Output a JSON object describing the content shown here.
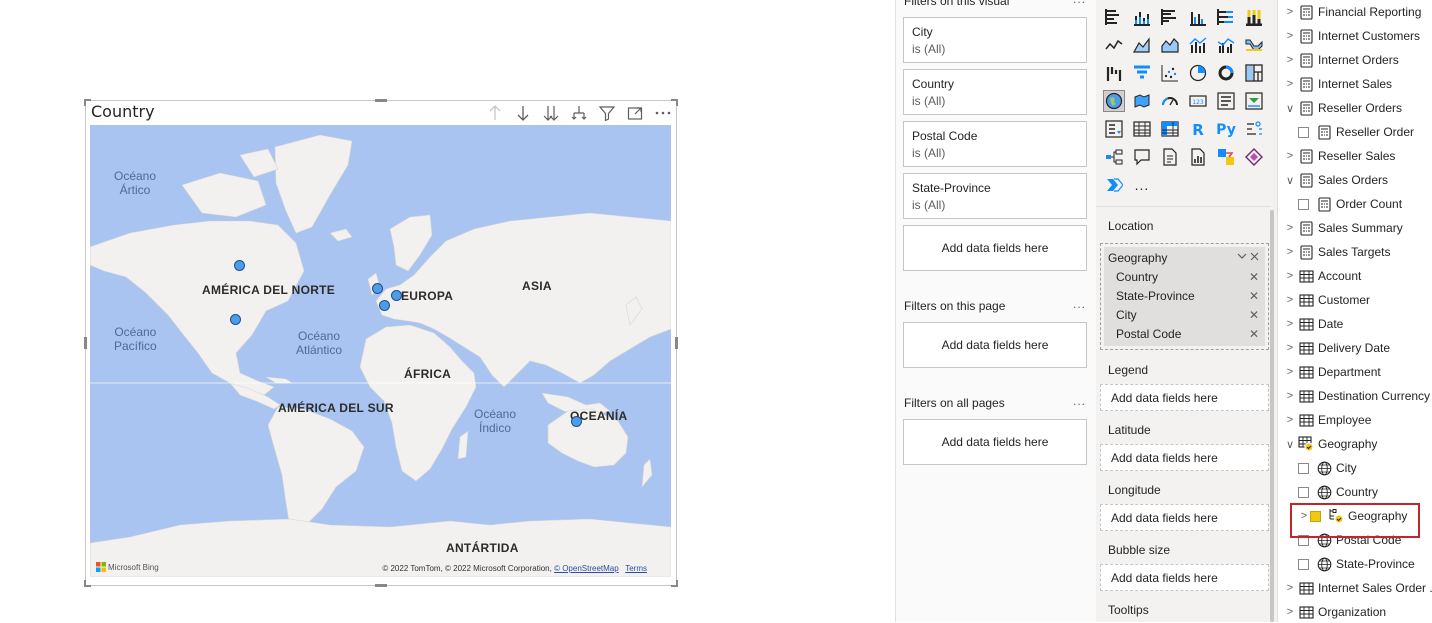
{
  "visual": {
    "title": "Country",
    "header_icons": [
      "arrow-up-icon",
      "arrow-down-icon",
      "expand-all-down-icon",
      "drill-hierarchy-icon",
      "filter-icon",
      "focus-mode-icon",
      "more-options-icon"
    ],
    "map": {
      "continent_labels": {
        "north_america": "AMÉRICA DEL NORTE",
        "europe": "EUROPA",
        "asia": "ASIA",
        "africa": "ÁFRICA",
        "south_america": "AMÉRICA DEL SUR",
        "oceania": "OCEANÍA",
        "antarctica": "ANTÁRTIDA"
      },
      "ocean_labels": {
        "arctic": "Océano\nÁrtico",
        "pacific": "Océano\nPacífico",
        "atlantic": "Océano\nAtlántico",
        "indian": "Océano\nÍndico"
      },
      "bing_logo": "Microsoft Bing",
      "attribution": "© 2022 TomTom, © 2022 Microsoft Corporation,",
      "osm_link": "© OpenStreetMap",
      "terms_link": "Terms"
    }
  },
  "filters": {
    "visual_header": "Filters on this visual",
    "visual_cards": [
      {
        "name": "City",
        "value": "is (All)"
      },
      {
        "name": "Country",
        "value": "is (All)"
      },
      {
        "name": "Postal Code",
        "value": "is (All)"
      },
      {
        "name": "State-Province",
        "value": "is (All)"
      }
    ],
    "add_fields": "Add data fields here",
    "page_header": "Filters on this page",
    "all_pages_header": "Filters on all pages",
    "more": "..."
  },
  "viz_pane": {
    "location_label": "Location",
    "geo_group": "Geography",
    "geo_fields": [
      "Country",
      "State-Province",
      "City",
      "Postal Code"
    ],
    "legend_label": "Legend",
    "latitude_label": "Latitude",
    "longitude_label": "Longitude",
    "bubble_size_label": "Bubble size",
    "tooltips_label": "Tooltips",
    "add_fields": "Add data fields here",
    "more_visuals": "..."
  },
  "fields_pane": {
    "items": [
      {
        "label": "Financial Reporting",
        "kind": "measure-table",
        "expanded": false
      },
      {
        "label": "Internet Customers",
        "kind": "measure-table",
        "expanded": false
      },
      {
        "label": "Internet Orders",
        "kind": "measure-table",
        "expanded": false
      },
      {
        "label": "Internet Sales",
        "kind": "measure-table",
        "expanded": false
      },
      {
        "label": "Reseller Orders",
        "kind": "measure-table",
        "expanded": true
      },
      {
        "label": "Reseller Order",
        "kind": "measure",
        "child": true
      },
      {
        "label": "Reseller Sales",
        "kind": "measure-table",
        "expanded": false
      },
      {
        "label": "Sales Orders",
        "kind": "measure-table",
        "expanded": true
      },
      {
        "label": "Order Count",
        "kind": "measure",
        "child": true
      },
      {
        "label": "Sales Summary",
        "kind": "measure-table",
        "expanded": false
      },
      {
        "label": "Sales Targets",
        "kind": "measure-table",
        "expanded": false
      },
      {
        "label": "Account",
        "kind": "table",
        "expanded": false
      },
      {
        "label": "Customer",
        "kind": "table",
        "expanded": false
      },
      {
        "label": "Date",
        "kind": "table",
        "expanded": false
      },
      {
        "label": "Delivery Date",
        "kind": "table",
        "expanded": false
      },
      {
        "label": "Department",
        "kind": "table",
        "expanded": false
      },
      {
        "label": "Destination Currency",
        "kind": "table",
        "expanded": false
      },
      {
        "label": "Employee",
        "kind": "table",
        "expanded": false
      },
      {
        "label": "Geography",
        "kind": "table-active",
        "expanded": true
      },
      {
        "label": "City",
        "kind": "globe",
        "child": true
      },
      {
        "label": "Country",
        "kind": "globe",
        "child": true
      },
      {
        "label": "Geography",
        "kind": "hierarchy",
        "child": true,
        "checked": true
      },
      {
        "label": "Postal Code",
        "kind": "globe",
        "child": true
      },
      {
        "label": "State-Province",
        "kind": "globe",
        "child": true
      },
      {
        "label": "Internet Sales Order ...",
        "kind": "table",
        "expanded": false
      },
      {
        "label": "Organization",
        "kind": "table",
        "expanded": false
      }
    ]
  },
  "colors": {
    "ocean": "#a9c4f0",
    "land": "#f2f1ef",
    "marker": "#4d9cea",
    "highlight": "#c0272d",
    "accent_yellow": "#f2c811"
  }
}
